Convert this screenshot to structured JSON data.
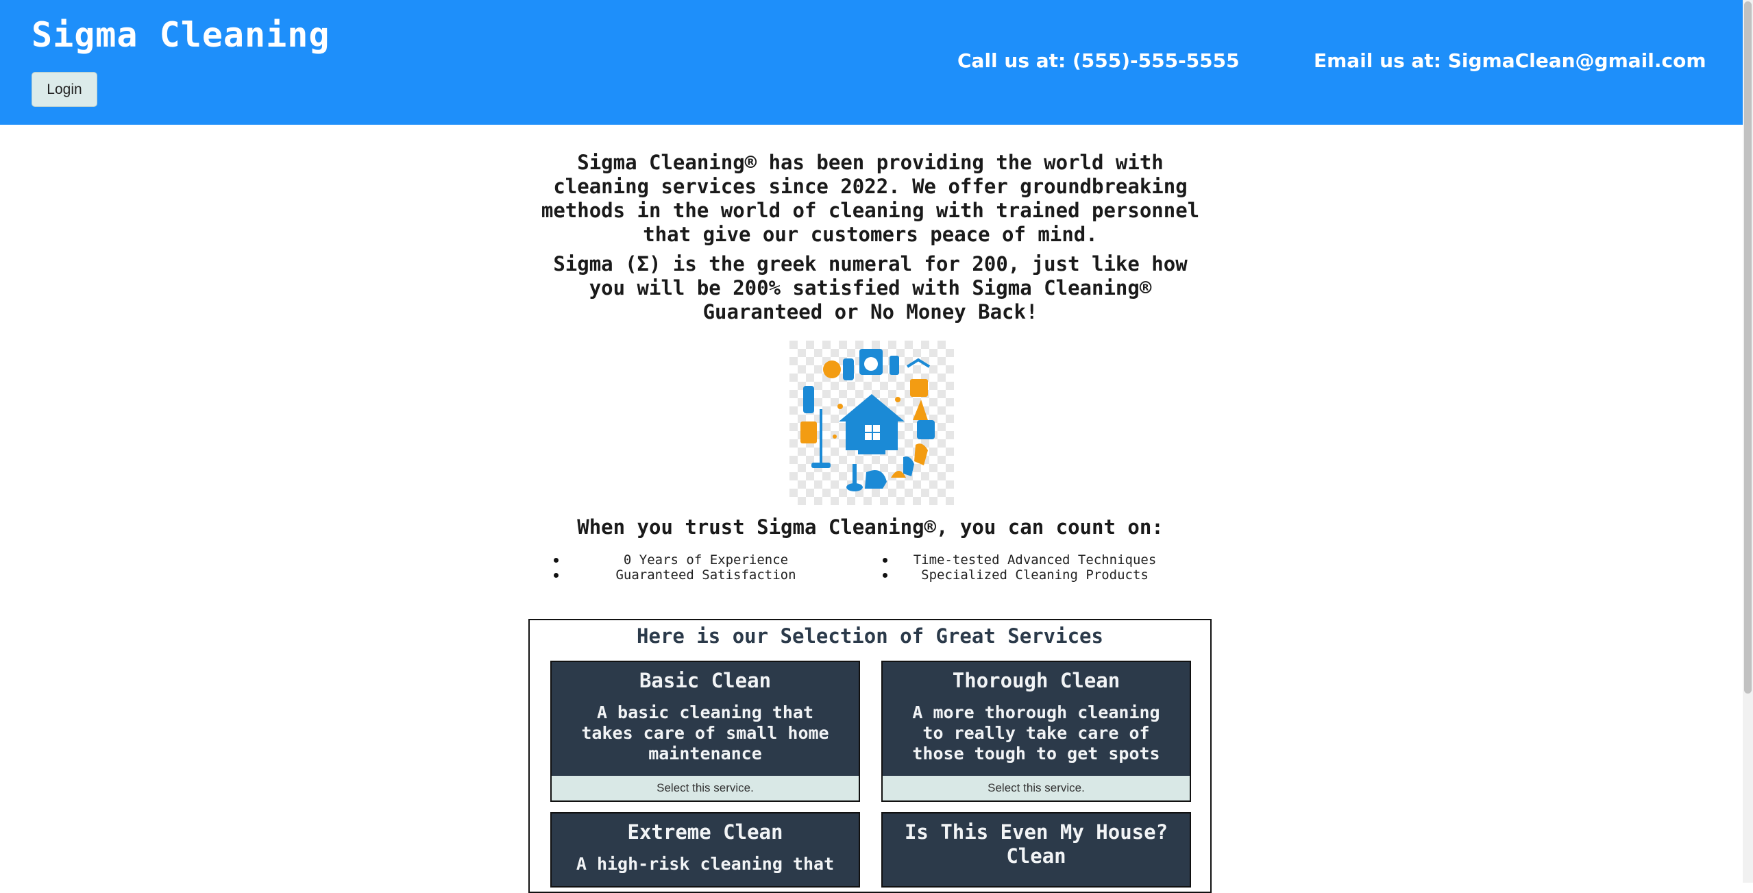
{
  "header": {
    "brand": "Sigma Cleaning",
    "login_label": "Login",
    "phone_text": "Call us at: (555)-555-5555",
    "email_text": "Email us at: SigmaClean@gmail.com",
    "background_color": "#1e8ffa"
  },
  "intro": {
    "paragraph_1": "Sigma Cleaning® has been providing the world with cleaning services since 2022. We offer groundbreaking methods in the world of cleaning with trained personnel that give our customers peace of mind.",
    "paragraph_2": "Sigma (Σ) is the greek numeral for 200, just like how you will be 200% satisfied with Sigma Cleaning® Guaranteed or No Money Back!",
    "image_icon": "house-cleaning-icons-image"
  },
  "trust": {
    "heading": "When you trust Sigma Cleaning®, you can count on:",
    "features": [
      "0 Years of Experience",
      "Time-tested Advanced Techniques",
      "Guaranteed Satisfaction",
      "Specialized Cleaning Products"
    ]
  },
  "services": {
    "title": "Here is our Selection of Great Services",
    "select_label": "Select this service.",
    "cards": [
      {
        "title": "Basic Clean",
        "description": "A basic cleaning that takes care of small home maintenance"
      },
      {
        "title": "Thorough Clean",
        "description": "A more thorough cleaning to really take care of those tough to get spots"
      },
      {
        "title": "Extreme Clean",
        "description": "A high-risk cleaning that"
      },
      {
        "title": "Is This Even My House? Clean",
        "description": ""
      }
    ],
    "card_color": "#2c3a4a"
  }
}
